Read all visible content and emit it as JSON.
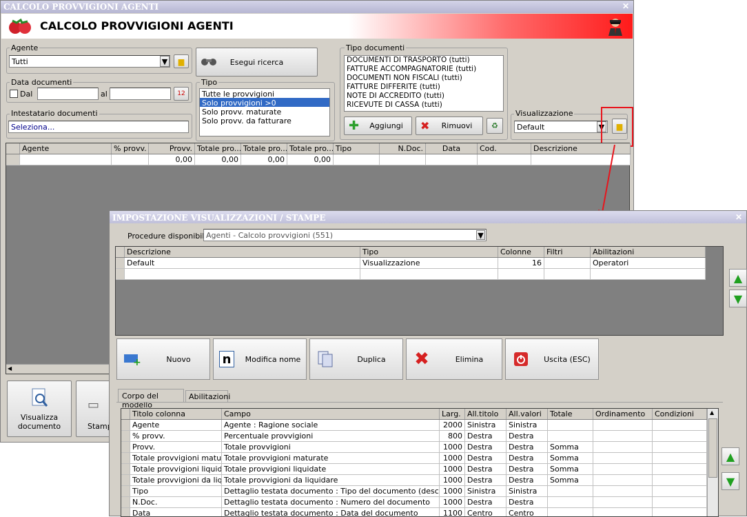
{
  "main_window": {
    "title": "CALCOLO PROVVIGIONI AGENTI",
    "header_title": "CALCOLO PROVVIGIONI AGENTI",
    "agente": {
      "label": "Agente",
      "value": "Tutti"
    },
    "search_button": "Esegui ricerca",
    "data_documenti": {
      "label": "Data documenti",
      "dal": "Dal",
      "al": "al"
    },
    "intestatario": {
      "label": "Intestatario documenti",
      "value": "Seleziona..."
    },
    "tipo": {
      "label": "Tipo",
      "items": [
        "Tutte le provvigioni",
        "Solo provvigioni >0",
        "Solo provv. maturate",
        "Solo provv. da fatturare"
      ],
      "selected": "Solo provvigioni >0"
    },
    "tipo_documenti": {
      "label": "Tipo documenti",
      "items": [
        "DOCUMENTI DI TRASPORTO (tutti)",
        "FATTURE ACCOMPAGNATORIE (tutti)",
        "DOCUMENTI NON FISCALI (tutti)",
        "FATTURE DIFFERITE (tutti)",
        "NOTE DI ACCREDITO (tutti)",
        "RICEVUTE DI CASSA (tutti)"
      ]
    },
    "aggiungi": "Aggiungi",
    "rimuovi": "Rimuovi",
    "visualizzazione": {
      "label": "Visualizzazione",
      "value": "Default"
    },
    "grid_columns": [
      "Agente",
      "% provv.",
      "Provv.",
      "Totale pro...",
      "Totale pro...",
      "Totale pro...",
      "Tipo",
      "N.Doc.",
      "Data",
      "Cod.",
      "Descrizione"
    ],
    "grid_totals": [
      "",
      "",
      "0,00",
      "0,00",
      "0,00",
      "0,00",
      "",
      "",
      "",
      "",
      ""
    ],
    "bottom_buttons": {
      "visualizza": "Visualizza documento",
      "stampa": "Stamp"
    }
  },
  "dialog": {
    "title": "IMPOSTAZIONE VISUALIZZAZIONI / STAMPE",
    "procedure_label": "Procedure disponibili :",
    "procedure_value": "Agenti - Calcolo provvigioni (551)",
    "top_columns": [
      "Descrizione",
      "Tipo",
      "Colonne",
      "Filtri",
      "Abilitazioni"
    ],
    "top_rows": [
      [
        "Default",
        "Visualizzazione",
        "16",
        "",
        "Operatori"
      ],
      [
        "",
        "",
        "",
        "",
        ""
      ]
    ],
    "buttons": {
      "nuovo": "Nuovo",
      "modifica": "Modifica nome",
      "duplica": "Duplica",
      "elimina": "Elimina",
      "uscita": "Uscita (ESC)"
    },
    "tabs": [
      "Corpo del modello",
      "Abilitazioni"
    ],
    "bottom_columns": [
      "Titolo colonna",
      "Campo",
      "Larg.",
      "All.titolo",
      "All.valori",
      "Totale",
      "Ordinamento",
      "Condizioni"
    ],
    "bottom_rows": [
      [
        "Agente",
        "Agente : Ragione sociale",
        "2000",
        "Sinistra",
        "Sinistra",
        "",
        "",
        ""
      ],
      [
        "% provv.",
        "Percentuale provvigioni",
        "800",
        "Destra",
        "Destra",
        "",
        "",
        ""
      ],
      [
        "Provv.",
        "Totale provvigioni",
        "1000",
        "Destra",
        "Destra",
        "Somma",
        "",
        ""
      ],
      [
        "Totale provvigioni matu...",
        "Totale provvigioni maturate",
        "1000",
        "Destra",
        "Destra",
        "Somma",
        "",
        ""
      ],
      [
        "Totale provvigioni liquid...",
        "Totale provvigioni liquidate",
        "1000",
        "Destra",
        "Destra",
        "Somma",
        "",
        ""
      ],
      [
        "Totale provvigioni da liq...",
        "Totale provvigioni da liquidare",
        "1000",
        "Destra",
        "Destra",
        "Somma",
        "",
        ""
      ],
      [
        "Tipo",
        "Dettaglio testata documento : Tipo del documento (descrizion...",
        "1000",
        "Sinistra",
        "Sinistra",
        "",
        "",
        ""
      ],
      [
        "N.Doc.",
        "Dettaglio testata documento : Numero del documento",
        "1000",
        "Destra",
        "Destra",
        "",
        "",
        ""
      ],
      [
        "Data",
        "Dettaglio testata documento : Data del documento",
        "1100",
        "Centro",
        "Centro",
        "",
        "",
        ""
      ]
    ]
  },
  "colors": {
    "highlight": "#e8141c",
    "selection": "#316ac5"
  }
}
